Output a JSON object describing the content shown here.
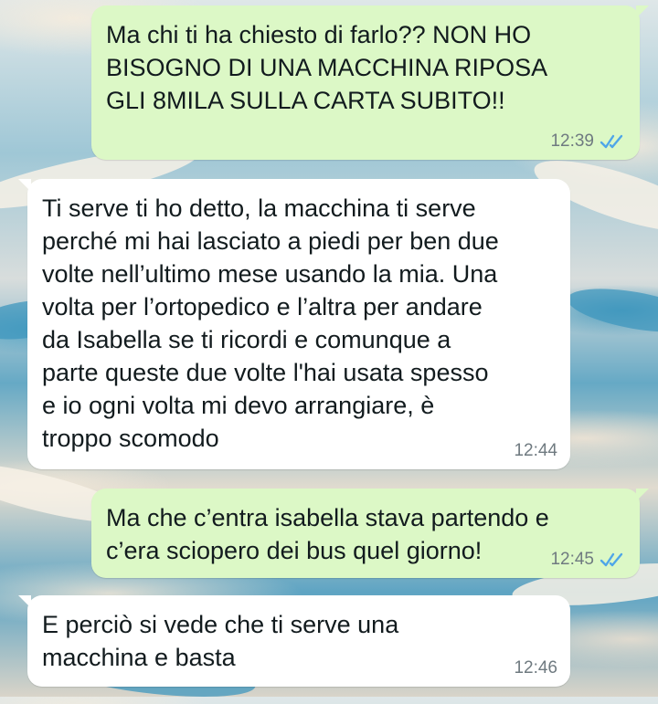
{
  "chat": {
    "messages": [
      {
        "direction": "outgoing",
        "text": "Ma chi ti ha chiesto di farlo?? NON HO\nBISOGNO DI UNA MACCHINA RIPOSA\nGLI 8MILA SULLA CARTA SUBITO!!",
        "time": "12:39",
        "status_icon": "double-check-read-icon"
      },
      {
        "direction": "incoming",
        "text": "Ti serve ti ho detto, la macchina ti serve\nperché mi hai lasciato a piedi per ben due\nvolte nell’ultimo mese usando la mia. Una\nvolta per l’ortopedico e l’altra per andare\nda Isabella se ti ricordi e comunque a\nparte queste due volte l'hai usata spesso\ne io ogni volta mi devo arrangiare, è\ntroppo scomodo",
        "time": "12:44"
      },
      {
        "direction": "outgoing",
        "text": "Ma che c’entra isabella stava partendo e\nc’era sciopero dei bus quel giorno!",
        "time": "12:45",
        "status_icon": "double-check-read-icon"
      },
      {
        "direction": "incoming",
        "text": "E perciò si vede che ti serve una\nmacchina e basta",
        "time": "12:46"
      }
    ]
  },
  "colors": {
    "outgoing_bubble": "#dcf8c6",
    "incoming_bubble": "#ffffff",
    "read_ticks": "#4fa6e8",
    "time_text": "#6f7a80"
  }
}
